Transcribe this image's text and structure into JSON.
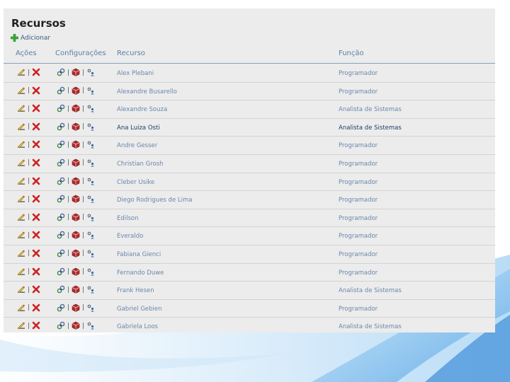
{
  "page": {
    "title": "Recursos",
    "add_label": "Adicionar"
  },
  "columns": {
    "acoes": "Ações",
    "configuracoes": "Configurações",
    "recurso": "Recurso",
    "funcao": "Função"
  },
  "icons": {
    "edit": "edit-icon",
    "delete": "delete-icon",
    "link": "link-icon",
    "box": "package-icon",
    "settings": "gear-user-icon",
    "add": "plus-icon"
  },
  "colors": {
    "panel_bg": "#ececec",
    "header_text": "#5a7fa8",
    "row_text": "#6b87aa",
    "highlight_text": "#1e3f66",
    "add_icon": "#3aa13a",
    "delete_icon": "#cc2222"
  },
  "rows": [
    {
      "recurso": "Alex Plebani",
      "funcao": "Programador"
    },
    {
      "recurso": "Alexandre Busarello",
      "funcao": "Programador"
    },
    {
      "recurso": "Alexandre Souza",
      "funcao": "Analista de Sistemas"
    },
    {
      "recurso": "Ana Luiza Osti",
      "funcao": "Analista de Sistemas",
      "highlight": true
    },
    {
      "recurso": "Andre Gesser",
      "funcao": "Programador"
    },
    {
      "recurso": "Christian Grosh",
      "funcao": "Programador"
    },
    {
      "recurso": "Cleber Usike",
      "funcao": "Programador"
    },
    {
      "recurso": "Diego Rodrigues de Lima",
      "funcao": "Programador"
    },
    {
      "recurso": "Edilson",
      "funcao": "Programador"
    },
    {
      "recurso": "Everaldo",
      "funcao": "Programador"
    },
    {
      "recurso": "Fabiana Gienci",
      "funcao": "Programador"
    },
    {
      "recurso": "Fernando Duwe",
      "funcao": "Programador"
    },
    {
      "recurso": "Frank Hesen",
      "funcao": "Analista de Sistemas"
    },
    {
      "recurso": "Gabriel Gebien",
      "funcao": "Programador"
    },
    {
      "recurso": "Gabriela Loos",
      "funcao": "Analista de Sistemas"
    }
  ]
}
